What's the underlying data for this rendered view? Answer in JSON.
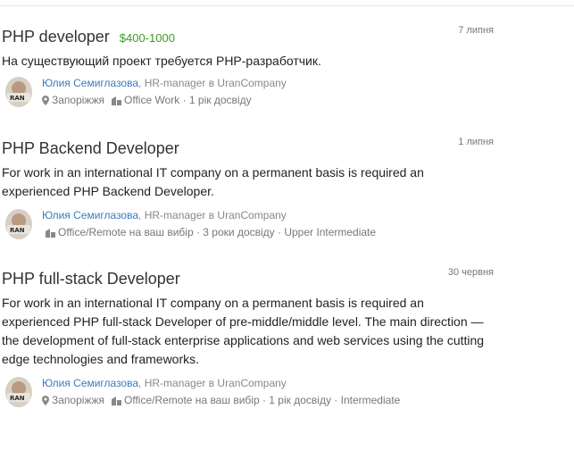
{
  "jobs": [
    {
      "title": "PHP developer",
      "salary": "$400-1000",
      "date": "7 липня",
      "description": "На существующий проект требуется PHP-разработчик.",
      "recruiter_name": "Юлия Семиглазова",
      "recruiter_role": ", HR-manager в UranCompany",
      "location": "Запоріжжя",
      "work_type": "Office Work",
      "experience": "1 рік досвіду",
      "english": ""
    },
    {
      "title": "PHP Backend Developer",
      "salary": "",
      "date": "1 липня",
      "description": "For work in an international IT company on a permanent basis is required an experienced PHP Backend Developer.",
      "recruiter_name": "Юлия Семиглазова",
      "recruiter_role": ", HR-manager в UranCompany",
      "location": "",
      "work_type": "Office/Remote на ваш вибір",
      "experience": "3 роки досвіду",
      "english": "Upper Intermediate"
    },
    {
      "title": "PHP full-stack Developer",
      "salary": "",
      "date": "30 червня",
      "description": "For work in an international IT company on a permanent basis is required an experienced PHP full-stack Developer of pre-middle/middle level. The main direction — the development of full-stack enterprise applications and web services using the cutting edge technologies and frameworks.",
      "recruiter_name": "Юлия Семиглазова",
      "recruiter_role": ", HR-manager в UranCompany",
      "location": "Запоріжжя",
      "work_type": "Office/Remote на ваш вибір",
      "experience": "1 рік досвіду",
      "english": "Intermediate"
    }
  ],
  "separator": " · ",
  "icons": {
    "location": "map-marker-icon",
    "office": "building-icon",
    "avatar": "recruiter-avatar"
  },
  "colors": {
    "salary": "#3c9a25",
    "link": "#3a7bbf"
  }
}
